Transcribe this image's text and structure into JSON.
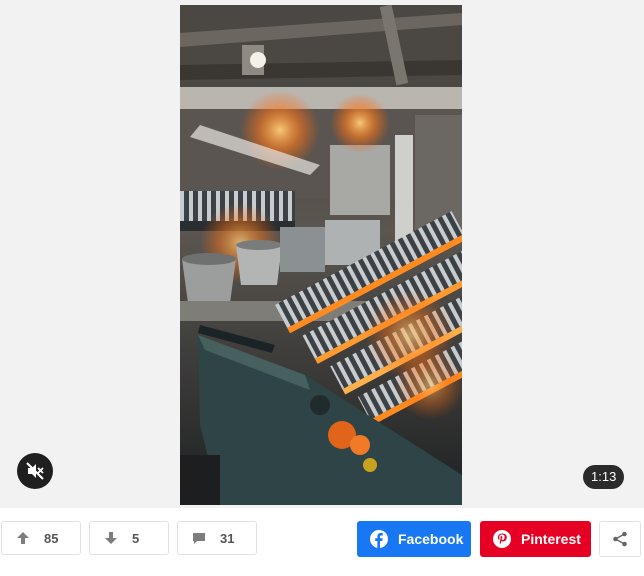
{
  "video": {
    "duration": "1:13",
    "mute_icon": "speaker-muted-icon"
  },
  "actions": {
    "upvotes": "85",
    "downvotes": "5",
    "comments": "31",
    "facebook_label": "Facebook",
    "pinterest_label": "Pinterest"
  },
  "colors": {
    "facebook": "#1877f2",
    "pinterest": "#e60023",
    "glow": "#ff8a1e"
  }
}
